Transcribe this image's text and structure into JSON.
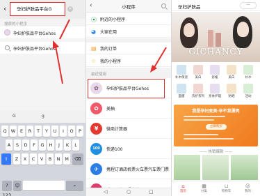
{
  "search_screen": {
    "query": "孕妇护肤品平台G",
    "clear_icon": "clear-icon",
    "section_label": "搜索的小程序",
    "results": [
      {
        "label": "孕妇护肤品平台Gehos",
        "icon": "miniprogram-logo"
      },
      {
        "label": "孕妇护肤品平台Gehos",
        "icon": "search-icon"
      }
    ],
    "keyboard": {
      "suggestions": [
        "G",
        "g"
      ],
      "row1": [
        "Q",
        "W",
        "E",
        "R",
        "T",
        "Y",
        "U",
        "I",
        "O",
        "P"
      ],
      "row2": [
        "A",
        "S",
        "D",
        "F",
        "G",
        "H",
        "J",
        "K",
        "L"
      ],
      "row3": [
        "Z",
        "X",
        "C",
        "V",
        "B",
        "N",
        "M"
      ]
    }
  },
  "miniprogram_screen": {
    "title": "小程序",
    "menu": [
      {
        "label": "附近的小程序",
        "icon": "location-icon"
      },
      {
        "label": "大家在用",
        "icon": "people-icon"
      },
      {
        "label": "我的订单",
        "icon": "order-icon"
      },
      {
        "label": "我的小程序",
        "icon": "star-icon"
      }
    ],
    "recent_label": "最近使用",
    "recent": [
      {
        "label": "孕妇护肤品平台Gehos",
        "color": "#e9d9e8"
      },
      {
        "label": "美柚",
        "color": "#f05a6a"
      },
      {
        "label": "微商计算器",
        "color": "#e23a2f"
      },
      {
        "label": "快递100",
        "color": "#1f8fe0"
      },
      {
        "label": "携程订酒店机票火车票汽车票门票",
        "color": "#2a7de1"
      },
      {
        "label": "唯品严选品质之选",
        "color": "#e23a6a"
      }
    ]
  },
  "store_screen": {
    "title": "孕妇护肤品",
    "menu_capsule": "···",
    "banner_brand": "GICHANCY",
    "categories_row1": [
      "补水保湿",
      "美白",
      "舒缓",
      "美白",
      "补水"
    ],
    "categories_row2": [
      "面膜",
      "洗护系列",
      "身体护理",
      "防晒",
      "活动"
    ],
    "promo_title": "我是孕妇变美·孕不我漂亮",
    "promo_button": "立即购买",
    "section_heading": "—— 热销爆款 ——",
    "tabs": [
      {
        "label": "首页",
        "icon": "home-icon",
        "active": true
      },
      {
        "label": "分类",
        "icon": "grid-icon",
        "active": false
      },
      {
        "label": "购物车",
        "icon": "cart-icon",
        "active": false
      },
      {
        "label": "我的",
        "icon": "user-icon",
        "active": false
      }
    ]
  },
  "colors": {
    "highlight": "#e0312e",
    "keyboard_blue": "#3478f6",
    "promo_orange": "#f07a1e"
  }
}
